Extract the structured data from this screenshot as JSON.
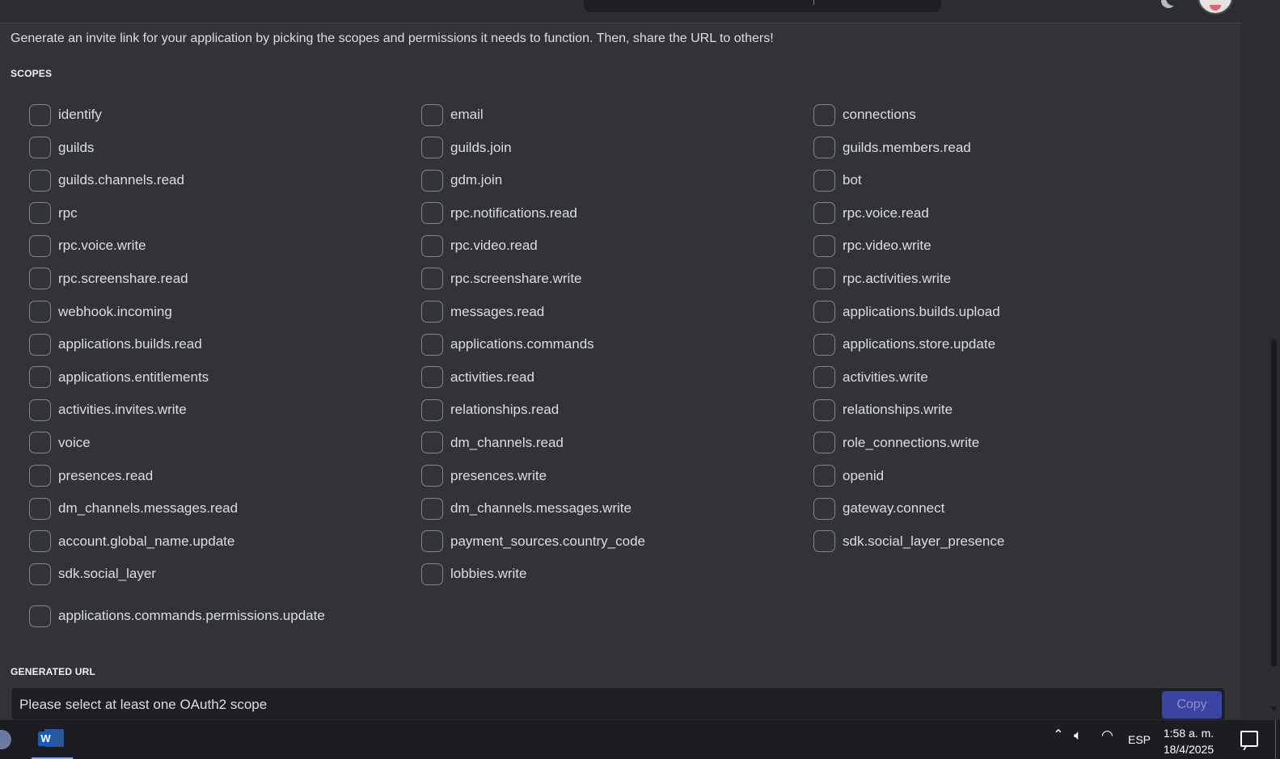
{
  "page": {
    "intro": "Generate an invite link for your application by picking the scopes and permissions it needs to function. Then, share the URL to others!",
    "scopes_title": "SCOPES",
    "generated_url_title": "GENERATED URL"
  },
  "scopes": [
    {
      "label": "identify",
      "checked": false
    },
    {
      "label": "email",
      "checked": false
    },
    {
      "label": "connections",
      "checked": false
    },
    {
      "label": "guilds",
      "checked": false
    },
    {
      "label": "guilds.join",
      "checked": false
    },
    {
      "label": "guilds.members.read",
      "checked": false
    },
    {
      "label": "guilds.channels.read",
      "checked": false
    },
    {
      "label": "gdm.join",
      "checked": false
    },
    {
      "label": "bot",
      "checked": false
    },
    {
      "label": "rpc",
      "checked": false
    },
    {
      "label": "rpc.notifications.read",
      "checked": false
    },
    {
      "label": "rpc.voice.read",
      "checked": false
    },
    {
      "label": "rpc.voice.write",
      "checked": false
    },
    {
      "label": "rpc.video.read",
      "checked": false
    },
    {
      "label": "rpc.video.write",
      "checked": false
    },
    {
      "label": "rpc.screenshare.read",
      "checked": false
    },
    {
      "label": "rpc.screenshare.write",
      "checked": false
    },
    {
      "label": "rpc.activities.write",
      "checked": false
    },
    {
      "label": "webhook.incoming",
      "checked": false
    },
    {
      "label": "messages.read",
      "checked": false
    },
    {
      "label": "applications.builds.upload",
      "checked": false
    },
    {
      "label": "applications.builds.read",
      "checked": false
    },
    {
      "label": "applications.commands",
      "checked": false
    },
    {
      "label": "applications.store.update",
      "checked": false
    },
    {
      "label": "applications.entitlements",
      "checked": false
    },
    {
      "label": "activities.read",
      "checked": false
    },
    {
      "label": "activities.write",
      "checked": false
    },
    {
      "label": "activities.invites.write",
      "checked": false
    },
    {
      "label": "relationships.read",
      "checked": false
    },
    {
      "label": "relationships.write",
      "checked": false
    },
    {
      "label": "voice",
      "checked": false
    },
    {
      "label": "dm_channels.read",
      "checked": false
    },
    {
      "label": "role_connections.write",
      "checked": false
    },
    {
      "label": "presences.read",
      "checked": false
    },
    {
      "label": "presences.write",
      "checked": false
    },
    {
      "label": "openid",
      "checked": false
    },
    {
      "label": "dm_channels.messages.read",
      "checked": false
    },
    {
      "label": "dm_channels.messages.write",
      "checked": false
    },
    {
      "label": "gateway.connect",
      "checked": false
    },
    {
      "label": "account.global_name.update",
      "checked": false
    },
    {
      "label": "payment_sources.country_code",
      "checked": false
    },
    {
      "label": "sdk.social_layer_presence",
      "checked": false
    },
    {
      "label": "sdk.social_layer",
      "checked": false
    },
    {
      "label": "lobbies.write",
      "checked": false
    }
  ],
  "extra_scope": {
    "label": "applications.commands.permissions.update",
    "checked": false
  },
  "generated_url": {
    "placeholder": "Please select at least one OAuth2 scope",
    "copy_label": "Copy"
  },
  "taskbar": {
    "pinned": [
      {
        "icon": "app-icon"
      },
      {
        "icon": "word-icon",
        "letter": "W",
        "active": true
      }
    ],
    "tray": {
      "language": "ESP",
      "time": "1:58 a. m.",
      "date": "18/4/2025"
    }
  },
  "colors": {
    "background": "#313338",
    "panel": "#2b2d31",
    "input": "#1e1f22",
    "text": "#dbdee1",
    "accent": "#3c44a2",
    "taskbar": "#1c1c22"
  }
}
